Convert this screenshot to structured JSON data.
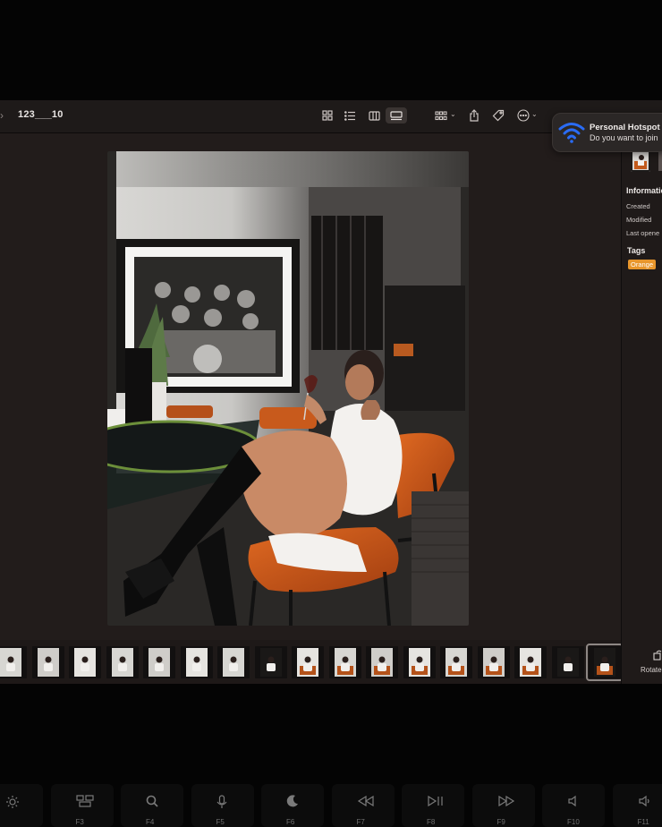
{
  "toolbar": {
    "back": "›",
    "folder_title": "123___10",
    "view_icons": [
      "grid-view-icon",
      "list-view-icon",
      "columns-view-icon",
      "gallery-view-icon"
    ],
    "action_icons": [
      "group-icon",
      "share-icon",
      "tag-icon",
      "more-icon"
    ]
  },
  "notification": {
    "title": "Personal Hotspot A",
    "body": "Do you want to join ",
    "icon": "wifi-icon",
    "accent": "#2a6cf5"
  },
  "sidebar": {
    "info_title": "Informatio",
    "rows": [
      "Created",
      "Modified",
      "Last opene"
    ],
    "tags_title": "Tags",
    "tag": {
      "label": "Orange",
      "color": "#e8962c"
    }
  },
  "filmstrip": {
    "count": 17,
    "selected_index": 16
  },
  "rotate_label": "Rotate",
  "keyboard": {
    "keys": [
      {
        "icon": "brightness-icon",
        "label": ""
      },
      {
        "icon": "mission-control-icon",
        "label": "F3"
      },
      {
        "icon": "search-icon",
        "label": "F4"
      },
      {
        "icon": "microphone-icon",
        "label": "F5"
      },
      {
        "icon": "moon-icon",
        "label": "F6"
      },
      {
        "icon": "rewind-icon",
        "label": "F7"
      },
      {
        "icon": "play-pause-icon",
        "label": "F8"
      },
      {
        "icon": "fast-forward-icon",
        "label": "F9"
      },
      {
        "icon": "mute-icon",
        "label": "F10"
      },
      {
        "icon": "volume-down-icon",
        "label": "F11"
      }
    ]
  }
}
